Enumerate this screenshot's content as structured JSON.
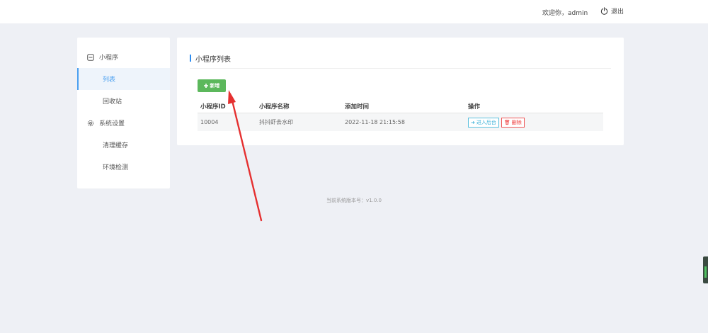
{
  "header": {
    "welcome": "欢迎你，admin",
    "logout_label": "退出"
  },
  "sidebar": {
    "groups": [
      {
        "label": "小程序",
        "icon": "app-icon",
        "items": [
          {
            "label": "列表",
            "active": true
          },
          {
            "label": "回收站",
            "active": false
          }
        ]
      },
      {
        "label": "系统设置",
        "icon": "gear-icon",
        "items": [
          {
            "label": "清理缓存",
            "active": false
          },
          {
            "label": "环境检测",
            "active": false
          }
        ]
      }
    ]
  },
  "main": {
    "title": "小程序列表",
    "add_label": "新增",
    "table": {
      "headers": [
        "小程序ID",
        "小程序名称",
        "添加时间",
        "操作"
      ],
      "rows": [
        {
          "id": "10004",
          "name": "抖抖虾去水印",
          "added": "2022-11-18 21:15:58",
          "enter_label": "进入后台",
          "delete_label": "删除"
        }
      ]
    }
  },
  "footer": {
    "version": "当前系统版本号：v1.0.0"
  },
  "colors": {
    "accent": "#2d8cf0",
    "add_button": "#5cb85c",
    "annotation_arrow": "#e53030"
  }
}
